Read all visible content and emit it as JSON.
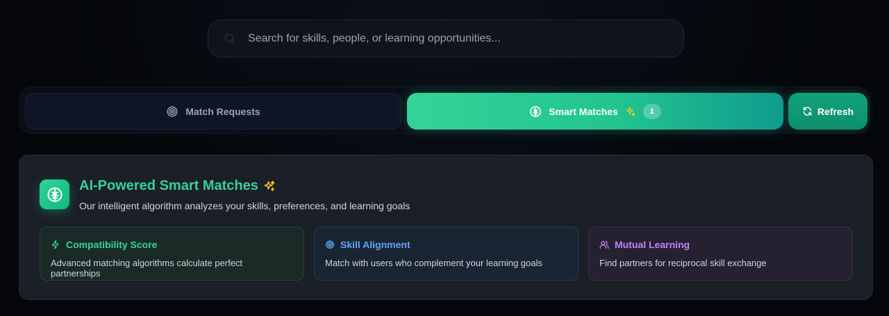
{
  "search": {
    "placeholder": "Search for skills, people, or learning opportunities...",
    "icon": "search-icon"
  },
  "tabs": {
    "requests": {
      "label": "Match Requests",
      "icon": "target-icon"
    },
    "smart": {
      "label": "Smart Matches",
      "icon": "brain-icon",
      "badge": "1"
    },
    "refresh": {
      "label": "Refresh",
      "icon": "refresh-icon"
    }
  },
  "panel": {
    "title": "AI-Powered Smart Matches",
    "subtitle": "Our intelligent algorithm analyzes your skills, preferences, and learning goals",
    "cards": [
      {
        "title": "Compatibility Score",
        "desc": "Advanced matching algorithms calculate perfect partnerships",
        "icon": "lightning-icon",
        "color": "#34d399"
      },
      {
        "title": "Skill Alignment",
        "desc": "Match with users who complement your learning goals",
        "icon": "target-icon",
        "color": "#60a5fa"
      },
      {
        "title": "Mutual Learning",
        "desc": "Find partners for reciprocal skill exchange",
        "icon": "users-icon",
        "color": "#c084fc"
      }
    ]
  },
  "colors": {
    "accent": "#34d399",
    "sparkle": "#facc15",
    "background": "#05070b"
  }
}
